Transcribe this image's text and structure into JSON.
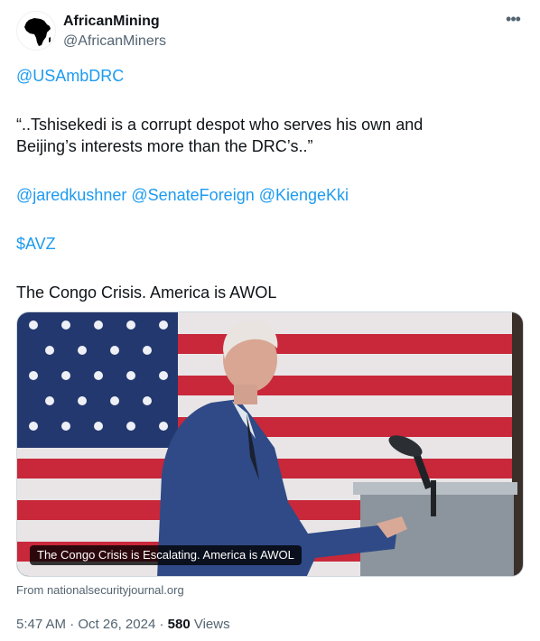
{
  "account": {
    "display_name": "AfricanMining",
    "handle": "@AfricanMiners",
    "avatar_icon": "africa-map-icon"
  },
  "menu": {
    "more_icon": "more-horizontal-icon"
  },
  "tweet": {
    "mention_ambassador": "@USAmbDRC",
    "quote_line_1": "“..Tshisekedi is a corrupt despot who serves his own and",
    "quote_line_2": "Beijing’s interests more than the DRC’s..”",
    "mentions": [
      "@jaredkushner",
      "@SenateForeign",
      "@KiengeKki"
    ],
    "cashtag": "$AVZ",
    "closing": "The Congo Crisis. America is AWOL"
  },
  "card": {
    "caption": "The Congo Crisis is Escalating. America is AWOL",
    "source": "From nationalsecurityjournal.org"
  },
  "meta": {
    "time": "5:47 AM",
    "separator": " · ",
    "date": "Oct 26, 2024",
    "views_count": "580",
    "views_label": "Views"
  },
  "colors": {
    "link": "#1d9bf0",
    "secondary": "#536471",
    "primary_text": "#0f1419"
  }
}
